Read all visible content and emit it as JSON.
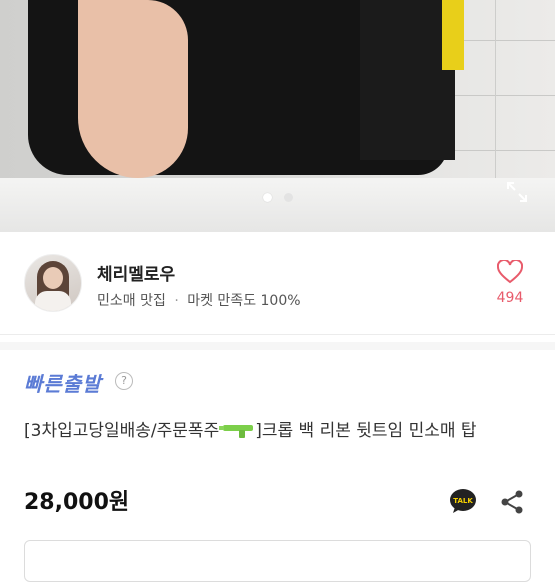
{
  "gallery": {
    "active_index": 0,
    "total": 2
  },
  "seller": {
    "name": "체리멜로우",
    "tagline": "민소매 맛집",
    "separator": "·",
    "rating_label": "마켓 만족도 100%",
    "like_count": "494"
  },
  "badge": {
    "fast_delivery": "빠른출발",
    "help": "?"
  },
  "product": {
    "title_part1": "[3차입고당일배송/주문폭주",
    "title_part2": "]크롭 백 리본 뒷트임 민소매 탑",
    "price": "28,000원"
  },
  "icons": {
    "expand": "expand-icon",
    "heart": "heart-icon",
    "talk": "kakao-talk-icon",
    "share": "share-icon",
    "emoji": "water-gun-emoji"
  },
  "colors": {
    "like": "#e85b6b",
    "fast": "#5b7bd5"
  }
}
